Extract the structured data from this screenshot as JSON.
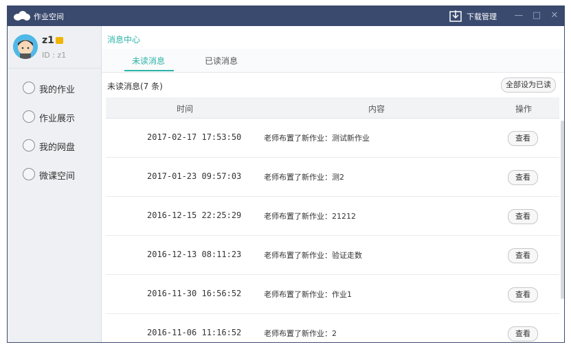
{
  "window": {
    "app_title": "作业空间",
    "download_label": "下载管理",
    "minimize": "—",
    "maximize": "□",
    "close": "✕"
  },
  "profile": {
    "username": "z1",
    "user_id": "ID : z1"
  },
  "sidebar": {
    "items": [
      {
        "label": "我的作业",
        "icon": "book-icon"
      },
      {
        "label": "作业展示",
        "icon": "trophy-icon"
      },
      {
        "label": "我的网盘",
        "icon": "cloud-icon"
      },
      {
        "label": "微课空间",
        "icon": "play-icon"
      }
    ]
  },
  "main": {
    "section_title": "消息中心",
    "tabs": [
      {
        "label": "未读消息",
        "active": true
      },
      {
        "label": "已读消息",
        "active": false
      }
    ],
    "unread_count": "未读消息(7 条)",
    "mark_all_label": "全部设为已读",
    "table": {
      "headers": [
        "时间",
        "内容",
        "操作"
      ],
      "rows": [
        {
          "time": "2017-02-17 17:53:50",
          "content": "老师布置了新作业：测试新作业",
          "action": "查看"
        },
        {
          "time": "2017-01-23 09:57:03",
          "content": "老师布置了新作业：测2",
          "action": "查看"
        },
        {
          "time": "2016-12-15 22:25:29",
          "content": "老师布置了新作业：21212",
          "action": "查看"
        },
        {
          "time": "2016-12-13 08:11:23",
          "content": "老师布置了新作业：验证走数",
          "action": "查看"
        },
        {
          "time": "2016-11-30 16:56:52",
          "content": "老师布置了新作业：作业1",
          "action": "查看"
        },
        {
          "time": "2016-11-06 11:16:52",
          "content": "老师布置了新作业：2",
          "action": "查看"
        }
      ]
    }
  },
  "colors": {
    "titlebar": "#3a4a6e",
    "accent": "#2bb3a8",
    "sidebar_bg": "#eef0f3"
  }
}
